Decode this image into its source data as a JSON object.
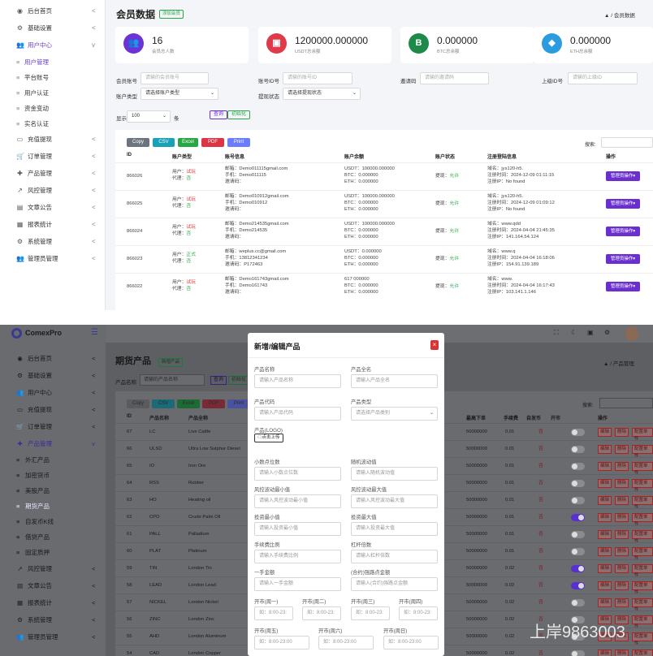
{
  "top": {
    "sidebar": [
      {
        "icon": "palette-icon",
        "label": "后台首页",
        "chev": "<"
      },
      {
        "icon": "gear-icon",
        "label": "基础设置",
        "chev": "<"
      },
      {
        "icon": "users-icon",
        "label": "用户中心",
        "chev": "v"
      },
      {
        "icon": "",
        "label": "用户管理",
        "sub": true,
        "active": true
      },
      {
        "icon": "",
        "label": "平台账号",
        "sub": true
      },
      {
        "icon": "",
        "label": "用户认证",
        "sub": true
      },
      {
        "icon": "",
        "label": "资金变动",
        "sub": true
      },
      {
        "icon": "",
        "label": "实名认证",
        "sub": true
      },
      {
        "icon": "card-icon",
        "label": "充值提现",
        "chev": "<"
      },
      {
        "icon": "cart-icon",
        "label": "订单管理",
        "chev": "<"
      },
      {
        "icon": "puzzle-icon",
        "label": "产品管理",
        "chev": "<"
      },
      {
        "icon": "chart-icon",
        "label": "风控管理",
        "chev": "<"
      },
      {
        "icon": "book-icon",
        "label": "文章公告",
        "chev": "<"
      },
      {
        "icon": "report-icon",
        "label": "报表统计",
        "chev": "<"
      },
      {
        "icon": "gear-icon",
        "label": "系统管理",
        "chev": "<"
      },
      {
        "icon": "users-icon",
        "label": "管理员管理",
        "chev": "<"
      }
    ],
    "page_title": "会员数据",
    "add_button": "添加会员",
    "breadcrumb": "会员数据",
    "breadcrumb_home": "▲",
    "breadcrumb_sep": "/",
    "cards": [
      {
        "value": "16",
        "label": "会员总人数",
        "color": "#6a35d4",
        "glyph": "👥"
      },
      {
        "value": "1200000.000000",
        "label": "USDT总余额",
        "color": "#e0394a",
        "glyph": "▣"
      },
      {
        "value": "0.000000",
        "label": "BTC总余额",
        "color": "#1e8a4a",
        "glyph": "B"
      },
      {
        "value": "0.000000",
        "label": "ETH总余额",
        "color": "#2d9be0",
        "glyph": "◆"
      }
    ],
    "filters": {
      "member_label": "会员账号",
      "member_ph": "请输的会员账号",
      "accountid_label": "账号ID号",
      "accountid_ph": "请输的账号ID",
      "invite_label": "邀请码",
      "invite_ph": "请输的邀请码",
      "parent_label": "上级ID号",
      "parent_ph": "请输的上级ID",
      "acctype_label": "账户类型",
      "acctype_val": "请选择账户类型",
      "withdraw_label": "提现状态",
      "withdraw_val": "请选择提现状态",
      "show_label": "显示",
      "show_val": "100",
      "show_unit": "条",
      "query_btn": "查询",
      "reset_btn": "初始化"
    },
    "export_buttons": [
      {
        "label": "Copy",
        "color": "#6c757d"
      },
      {
        "label": "CSV",
        "color": "#17a2b8"
      },
      {
        "label": "Excel",
        "color": "#28a745"
      },
      {
        "label": "PDF",
        "color": "#dc3545"
      },
      {
        "label": "Print",
        "color": "#6b7cff"
      }
    ],
    "search_label": "搜索:",
    "columns": [
      "ID",
      "账户类型",
      "账号信息",
      "账户余额",
      "账户状态",
      "注册登陆信息",
      "操作"
    ],
    "rows": [
      {
        "id": "866026",
        "utype": "试玩",
        "agent": "否",
        "email": "邮箱：Demo011115gmail.com",
        "phone": "手机：Demo011115",
        "invite": "邀请码：",
        "usdt": "USDT：100000.000000",
        "btc": "BTC：0.000000",
        "eth": "ETH：0.000000",
        "wd": "允许",
        "domain": "域名：jys120-h5.",
        "regtime": "注册时间：2024-12-09 01:11:15",
        "regip": "注册IP：No found"
      },
      {
        "id": "866025",
        "utype": "试玩",
        "agent": "否",
        "email": "邮箱：Demo010912gmail.com",
        "phone": "手机：Demo010912",
        "invite": "邀请码：",
        "usdt": "USDT：100000.000000",
        "btc": "BTC：0.000000",
        "eth": "ETH：0.000000",
        "wd": "允许",
        "domain": "域名：jys120-h5.",
        "regtime": "注册时间：2024-12-09 01:09:12",
        "regip": "注册IP：No found"
      },
      {
        "id": "866024",
        "utype": "试玩",
        "agent": "否",
        "email": "邮箱：Demo214535gmail.com",
        "phone": "手机：Demo214535",
        "invite": "邀请码：",
        "usdt": "USDT：100000.000000",
        "btc": "BTC：0.000000",
        "eth": "ETH：0.000000",
        "wd": "允许",
        "domain": "域名：www.qdd",
        "regtime": "注册时间：2024-04-04 21:45:35",
        "regip": "注册IP：141.164.54.124"
      },
      {
        "id": "866023",
        "utype": "正式",
        "agent": "否",
        "email": "邮箱：weplus.cc@gmail.com",
        "phone": "手机：13812341234",
        "invite": "邀请码：P172463",
        "usdt": "USDT：0.000000",
        "btc": "BTC：0.000000",
        "eth": "ETH：0.000000",
        "wd": "允许",
        "domain": "域名：www.q",
        "regtime": "注册时间：2024-04-04 16:18:06",
        "regip": "注册IP：154.91.139.189"
      },
      {
        "id": "866022",
        "utype": "试玩",
        "agent": "否",
        "email": "邮箱：Demo161743gmail.com",
        "phone": "手机：Demo161743",
        "invite": "邀请码：",
        "usdt": "617      000000",
        "btc": "BTC：0.000000",
        "eth": "ETH：0.000000",
        "wd": "允许",
        "domain": "域名：www.",
        "regtime": "注册时间：2024-04-04 16:17:43",
        "regip": "注册IP：103.141.1.146"
      }
    ],
    "user_prefix": "用户：",
    "agent_prefix": "代理：",
    "wd_prefix": "提现：",
    "op_btn": "管理员操作▾"
  },
  "bottom": {
    "logo": "ComexPro",
    "sidebar": [
      {
        "label": "后台首页",
        "chev": "<"
      },
      {
        "label": "基础设置",
        "chev": "<"
      },
      {
        "label": "用户中心",
        "chev": "<"
      },
      {
        "label": "充值提现",
        "chev": "<"
      },
      {
        "label": "订单管理",
        "chev": "<"
      },
      {
        "label": "产品管理",
        "chev": "v",
        "active": true
      },
      {
        "label": "外汇产品",
        "sub": true
      },
      {
        "label": "加密货币",
        "sub": true
      },
      {
        "label": "美股产品",
        "sub": true
      },
      {
        "label": "期货产品",
        "sub": true,
        "active": true
      },
      {
        "label": "自发币K线",
        "sub": true
      },
      {
        "label": "借贷产品",
        "sub": true
      },
      {
        "label": "固定质押",
        "sub": true
      },
      {
        "label": "风控管理",
        "chev": "<"
      },
      {
        "label": "文章公告",
        "chev": "<"
      },
      {
        "label": "报表统计",
        "chev": "<"
      },
      {
        "label": "系统管理",
        "chev": "<"
      },
      {
        "label": "管理员管理",
        "chev": "<"
      }
    ],
    "page_title": "期货产品",
    "add_button": "新增产品",
    "breadcrumb": "产品管理",
    "breadcrumb_home": "▲",
    "breadcrumb_sep": "/",
    "filter_label": "产品名称",
    "filter_ph": "请输的产品名称",
    "query_btn": "查询",
    "reset_btn": "初始化",
    "export_buttons": [
      "Copy",
      "CSV",
      "Excel",
      "PDF",
      "Print"
    ],
    "search_label": "搜索:",
    "columns": [
      "ID",
      "产品名称",
      "产品全称",
      "最高下单",
      "手续费",
      "自发币",
      "开市",
      "操作"
    ],
    "rows": [
      {
        "id": "67",
        "name": "LC",
        "full": "Live Cattle",
        "max": "50000000",
        "fee": "0.01",
        "self": "否",
        "on": false
      },
      {
        "id": "66",
        "name": "ULSD",
        "full": "Ultra Low Sulphur Diesel",
        "max": "50000000",
        "fee": "0.01",
        "self": "否",
        "on": false
      },
      {
        "id": "65",
        "name": "IO",
        "full": "Iron Ore",
        "max": "50000000",
        "fee": "0.01",
        "self": "否",
        "on": false
      },
      {
        "id": "64",
        "name": "RSS",
        "full": "Rubber",
        "max": "50000000",
        "fee": "0.01",
        "self": "否",
        "on": false
      },
      {
        "id": "63",
        "name": "HO",
        "full": "Heating oil",
        "max": "50000000",
        "fee": "0.01",
        "self": "否",
        "on": false
      },
      {
        "id": "62",
        "name": "CPO",
        "full": "Crude Palm Oil",
        "max": "50000000",
        "fee": "0.01",
        "self": "否",
        "on": true
      },
      {
        "id": "61",
        "name": "PALL",
        "full": "Palladium",
        "max": "50000000",
        "fee": "0.01",
        "self": "否",
        "on": false
      },
      {
        "id": "60",
        "name": "PLAT",
        "full": "Platinum",
        "max": "50000000",
        "fee": "0.01",
        "self": "否",
        "on": false
      },
      {
        "id": "59",
        "name": "TIN",
        "full": "London Tin",
        "max": "50000000",
        "fee": "0.02",
        "self": "否",
        "on": true
      },
      {
        "id": "58",
        "name": "LEAD",
        "full": "London Lead",
        "max": "50000000",
        "fee": "0.02",
        "self": "否",
        "on": true
      },
      {
        "id": "57",
        "name": "NICKEL",
        "full": "London Nickel",
        "max": "50000000",
        "fee": "0.02",
        "self": "否",
        "on": false
      },
      {
        "id": "56",
        "name": "ZINC",
        "full": "London Zinc",
        "max": "50000000",
        "fee": "0.02",
        "self": "否",
        "on": false
      },
      {
        "id": "55",
        "name": "AHD",
        "full": "London Aluminum",
        "max": "50000000",
        "fee": "0.02",
        "self": "否",
        "on": false
      },
      {
        "id": "54",
        "name": "CAD",
        "full": "London Copper",
        "max": "50000000",
        "fee": "0.02",
        "self": "否",
        "on": false
      }
    ],
    "row_buttons": [
      "编辑",
      "删除",
      "配置单性"
    ],
    "modal": {
      "title": "新增/编辑产品",
      "close": "×",
      "fields": [
        {
          "label": "产品名称",
          "ph": "请输入产品名称"
        },
        {
          "label": "产品全名",
          "ph": "请输入产品全名"
        },
        {
          "label": "产品代码",
          "ph": "请输入产品代码"
        },
        {
          "label": "产品类型",
          "ph": "请选择产品类别"
        },
        {
          "label": "小数点位数",
          "ph": "请输入小数点位数"
        },
        {
          "label": "随机波动值",
          "ph": "请输入随机波动值"
        },
        {
          "label": "风控波动最小值",
          "ph": "请输入风控波动最小值"
        },
        {
          "label": "风控波动最大值",
          "ph": "请输入风控波动最大值"
        },
        {
          "label": "投资最小值",
          "ph": "请输入投资最小值"
        },
        {
          "label": "投资最大值",
          "ph": "请输入投资最大值"
        },
        {
          "label": "手续费比例",
          "ph": "请输入手续费比例"
        },
        {
          "label": "杠杆倍数",
          "ph": "请输入杠杆倍数"
        },
        {
          "label": "一手金额",
          "ph": "请输入一手金额"
        },
        {
          "label": "(合约)强路点金额",
          "ph": "请输入(合约)强路点金额"
        }
      ],
      "logo_label": "产品(LOGO)",
      "upload_btn": "点击上传",
      "days": [
        {
          "label": "开市(周一)",
          "ph": "如：8:00-23:"
        },
        {
          "label": "开市(周二)",
          "ph": "如：8:00-23:"
        },
        {
          "label": "开市(周三)",
          "ph": "如：8:00-23:"
        },
        {
          "label": "开市(周四)",
          "ph": "如：8:00-23:"
        }
      ],
      "days2": [
        {
          "label": "开市(周五)",
          "ph": "如：8:00-23:00"
        },
        {
          "label": "开市(周六)",
          "ph": "如：8:00-23:00"
        },
        {
          "label": "开市(周日)",
          "ph": "如：8:00-23:00"
        }
      ]
    },
    "watermark": "上岸9863003"
  }
}
